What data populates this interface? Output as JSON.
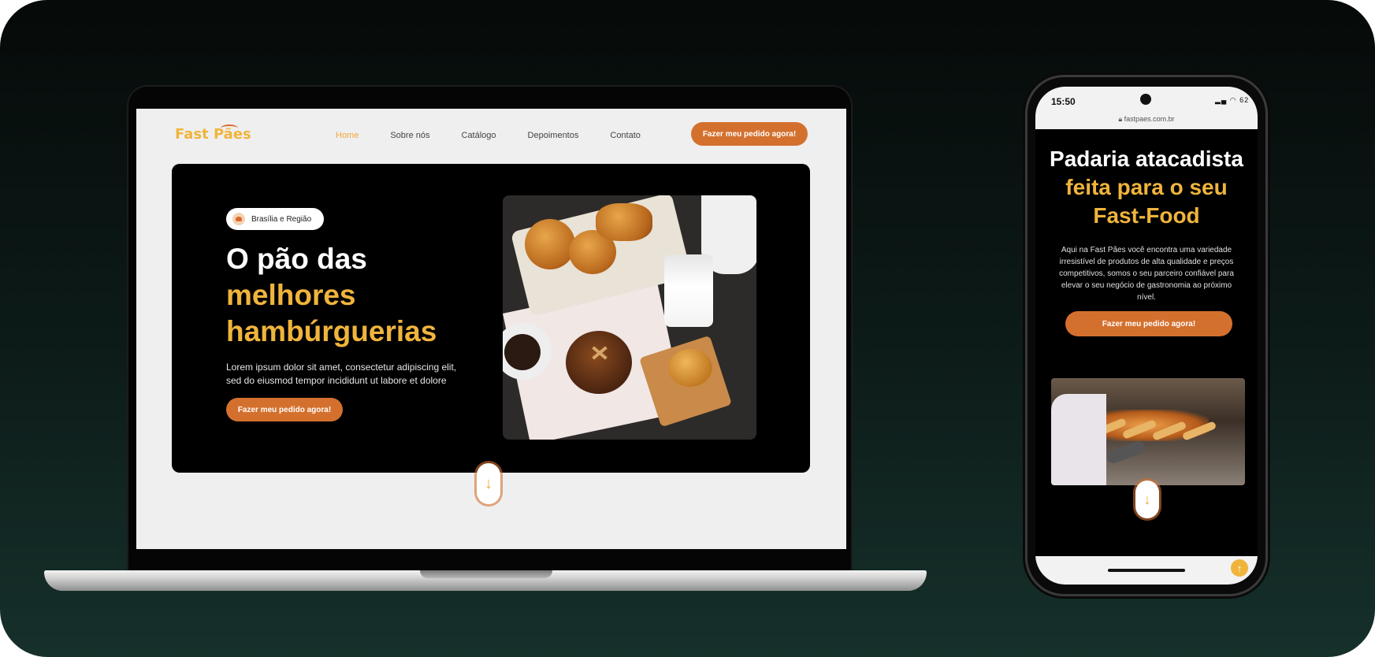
{
  "desktop": {
    "logo": "Fast Pães",
    "nav": [
      {
        "label": "Home",
        "active": true
      },
      {
        "label": "Sobre nós",
        "active": false
      },
      {
        "label": "Catálogo",
        "active": false
      },
      {
        "label": "Depoimentos",
        "active": false
      },
      {
        "label": "Contato",
        "active": false
      }
    ],
    "nav_cta": "Fazer meu pedido agora!",
    "badge": "Brasília e Região",
    "title_line1": "O pão das",
    "title_line2": "melhores",
    "title_line3": "hambúrguerias",
    "description": "Lorem ipsum dolor sit amet, consectetur adipiscing elit, sed do eiusmod tempor incididunt ut labore et dolore",
    "cta": "Fazer meu pedido agora!",
    "scroll_icon": "arrow-down-icon"
  },
  "mobile": {
    "time": "15:50",
    "status_icons": "▂▄ ◠ 62",
    "url": "fastpaes.com.br",
    "title_line1": "Padaria atacadista",
    "title_line2": "feita para o seu",
    "title_line3": "Fast-Food",
    "description": "Aqui na Fast Pães você encontra uma variedade irresistível de produtos de alta qualidade e preços competitivos, somos o seu parceiro confiável para elevar o seu negócio de gastronomia ao próximo nível.",
    "cta": "Fazer meu pedido agora!",
    "scroll_icon": "arrow-down-icon",
    "to_top_icon": "arrow-up-icon"
  },
  "colors": {
    "accent_orange": "#d4702e",
    "gold": "#f0b43c",
    "hero_bg": "#000000"
  }
}
